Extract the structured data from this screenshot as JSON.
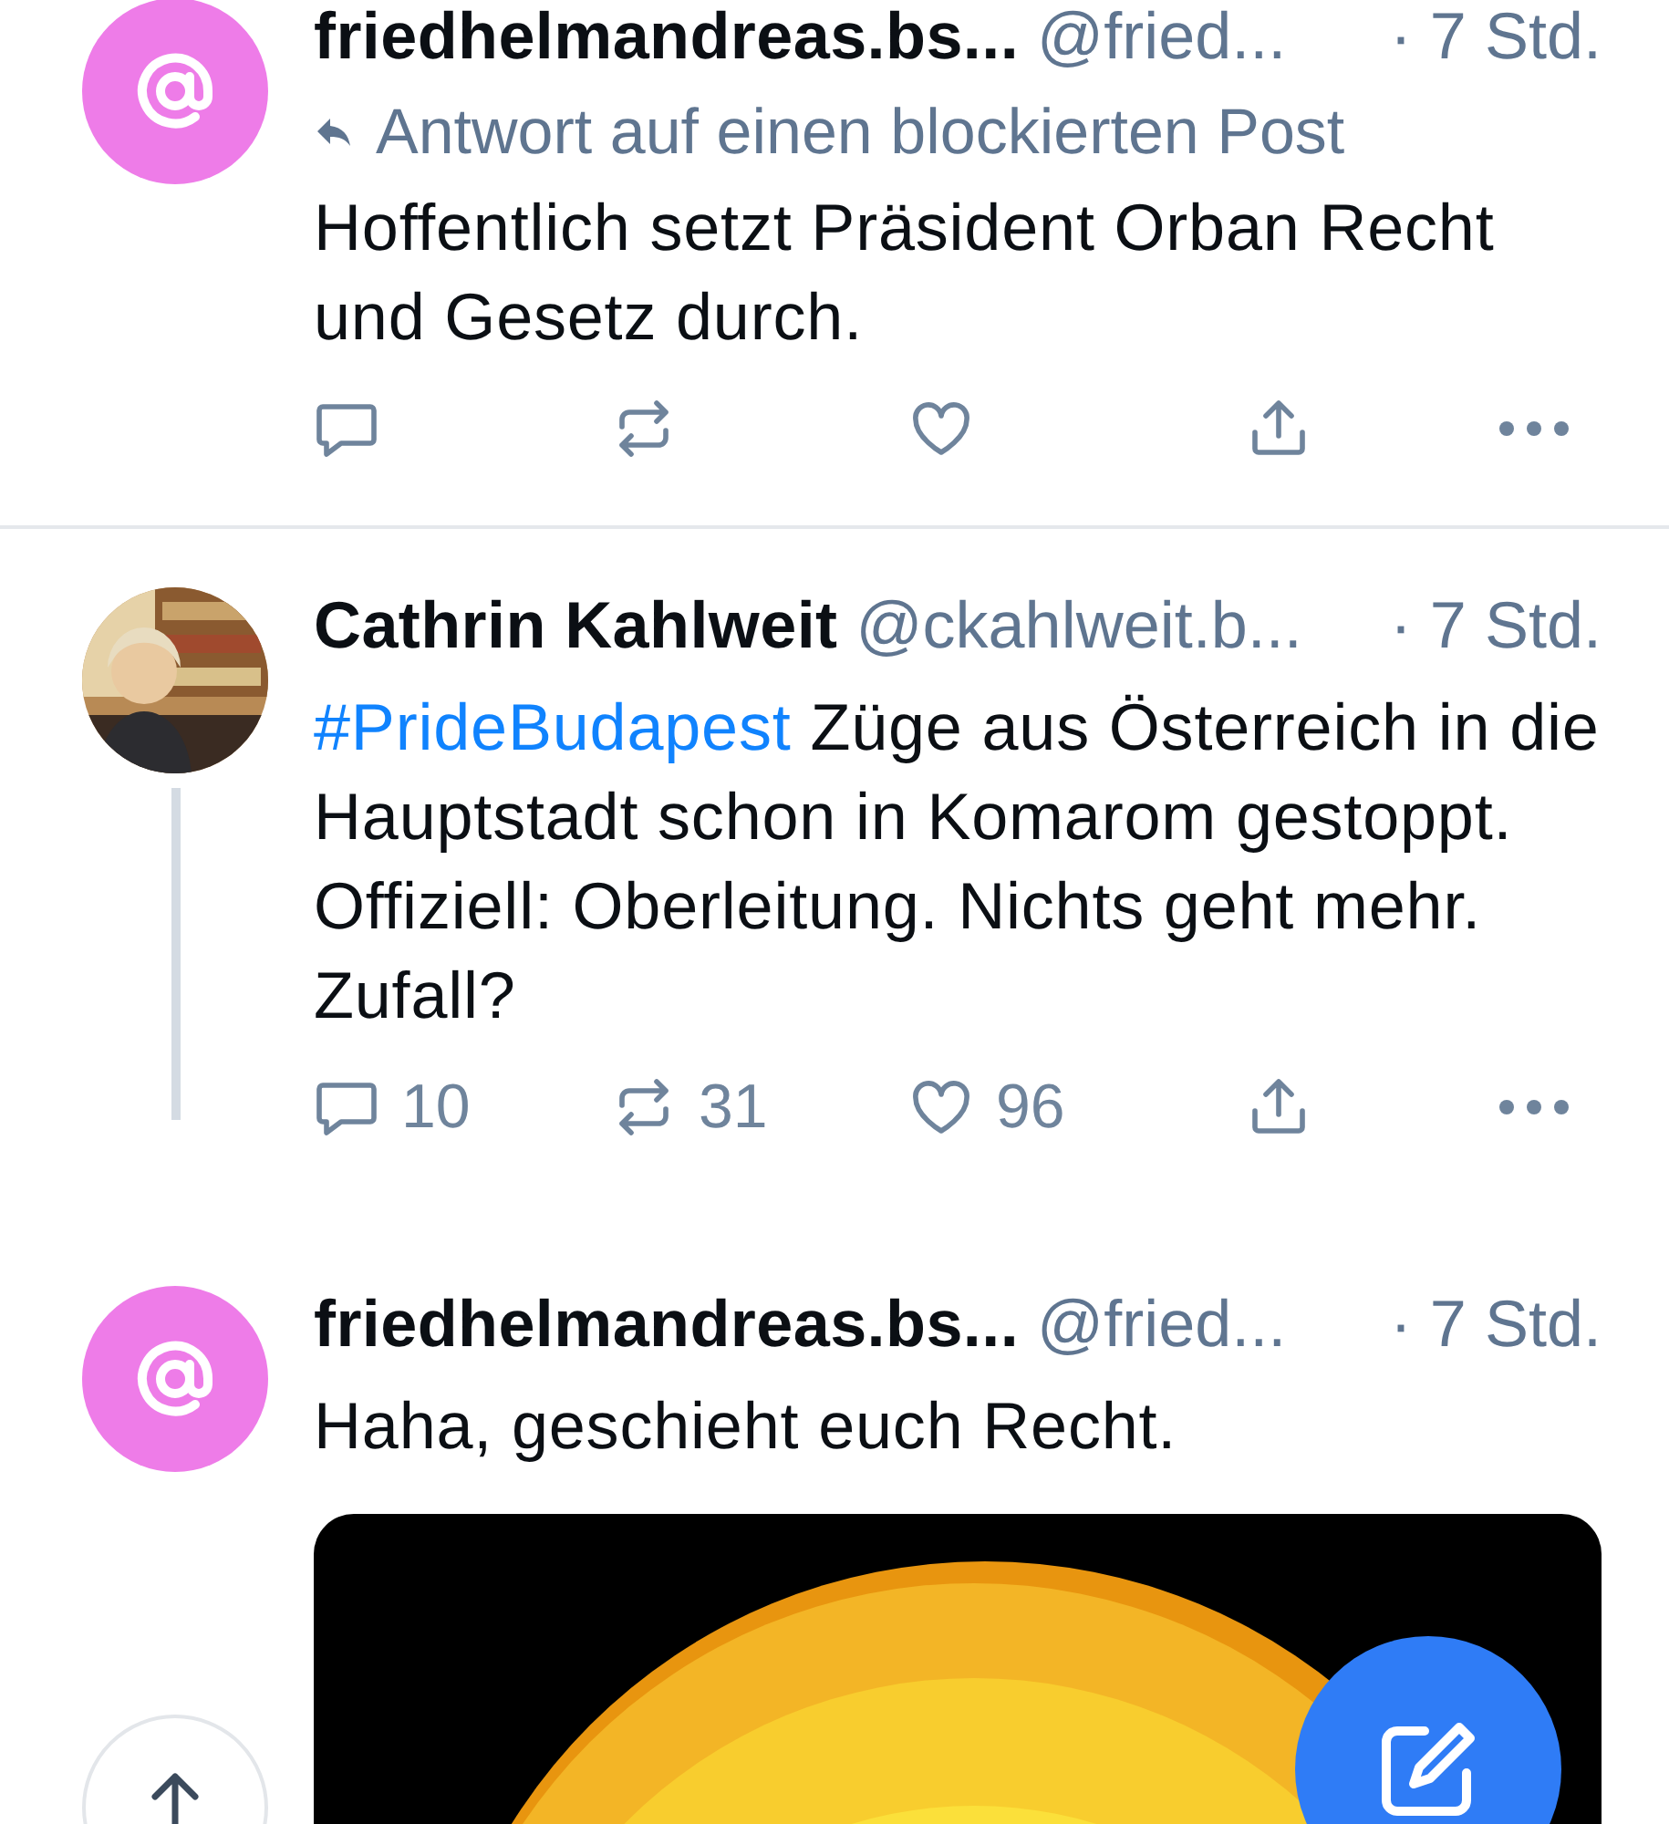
{
  "posts": [
    {
      "avatar": {
        "kind": "at"
      },
      "display_name": "friedhelmandreas.bs...",
      "handle": "@fried...",
      "time": "· 7 Std.",
      "reply_note": "Antwort auf einen blockierten Post",
      "text": [
        {
          "kind": "plain",
          "text": "Hoffentlich setzt Präsident Orban Recht und Gesetz durch."
        }
      ],
      "actions": [
        {
          "kind": "reply"
        },
        {
          "kind": "repost"
        },
        {
          "kind": "like"
        },
        {
          "kind": "share"
        },
        {
          "kind": "more"
        }
      ],
      "thread_line": false,
      "divider_after": true
    },
    {
      "avatar": {
        "kind": "picture"
      },
      "display_name": "Cathrin Kahlweit",
      "handle": "@ckahlweit.b...",
      "time": "· 7 Std.",
      "text": [
        {
          "kind": "hashtag",
          "text": "#PrideBudapest"
        },
        {
          "kind": "plain",
          "text": " Züge aus Österreich in die Hauptstadt schon in Komarom gestoppt. Offiziell: Oberleitung. Nichts geht mehr. Zufall?"
        }
      ],
      "actions": [
        {
          "kind": "reply",
          "count": "10"
        },
        {
          "kind": "repost",
          "count": "31"
        },
        {
          "kind": "like",
          "count": "96"
        },
        {
          "kind": "share"
        },
        {
          "kind": "more"
        }
      ],
      "thread_line": true,
      "divider_after": false
    },
    {
      "avatar": {
        "kind": "at"
      },
      "display_name": "friedhelmandreas.bs...",
      "handle": "@fried...",
      "time": "· 7 Std.",
      "text": [
        {
          "kind": "plain",
          "text": "Haha, geschieht euch Recht."
        }
      ],
      "image": {
        "kind": "picture"
      },
      "thread_line": false,
      "divider_after": false
    }
  ]
}
